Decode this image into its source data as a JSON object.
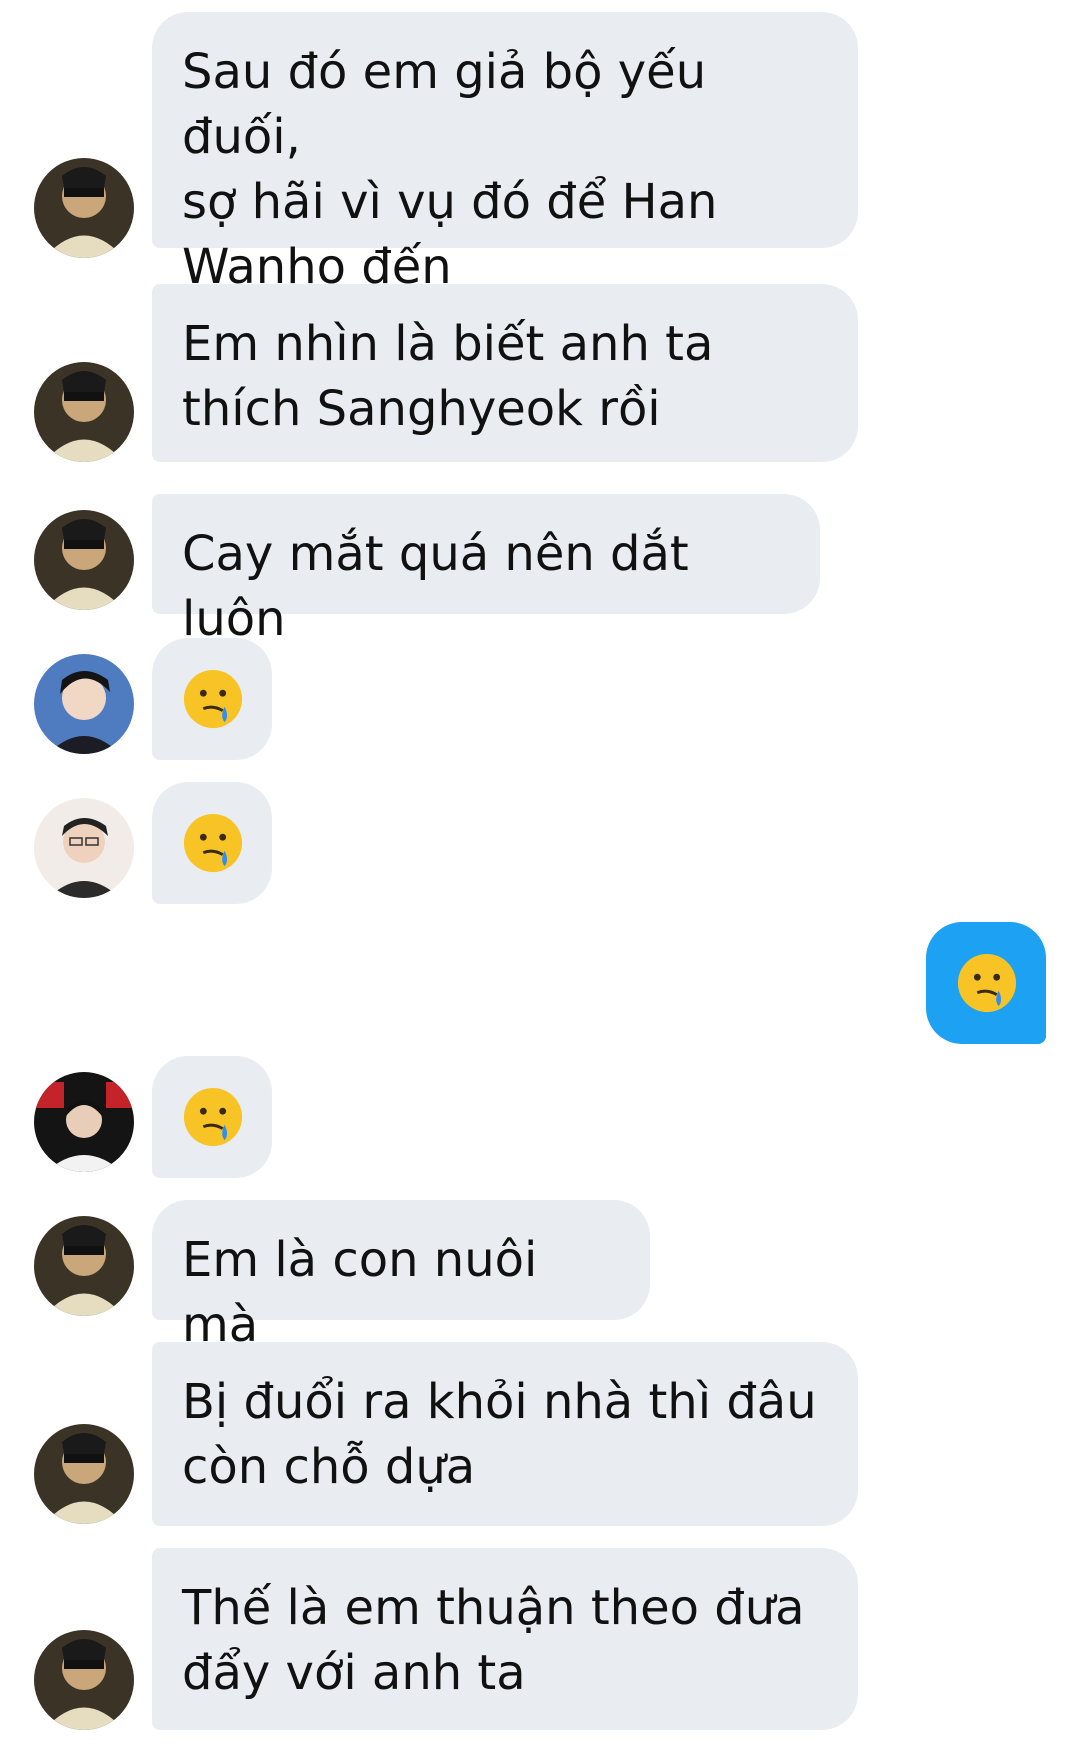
{
  "conversation": {
    "messages": [
      {
        "sender": "avatar-a",
        "text": "Sau đó em giả bộ yếu đuối,\nsợ hãi vì vụ đó để Han\nWanho đến"
      },
      {
        "sender": "avatar-a",
        "text": "Em nhìn là biết anh ta\nthích Sanghyeok rồi"
      },
      {
        "sender": "avatar-a",
        "text": "Cay mắt quá nên dắt luôn"
      },
      {
        "sender": "avatar-b",
        "emoji": "face-holding-back-tears"
      },
      {
        "sender": "avatar-c",
        "emoji": "face-holding-back-tears"
      },
      {
        "sender": "me",
        "emoji": "face-holding-back-tears"
      },
      {
        "sender": "avatar-d",
        "emoji": "face-holding-back-tears"
      },
      {
        "sender": "avatar-a",
        "text": "Em là con nuôi mà"
      },
      {
        "sender": "avatar-a",
        "text": "Bị đuổi ra khỏi nhà thì đâu\ncòn chỗ dựa"
      },
      {
        "sender": "avatar-a",
        "text": "Thế là em thuận theo đưa\nđẩy với anh ta"
      }
    ]
  },
  "colors": {
    "incoming_bubble": "#e9edf2",
    "outgoing_bubble": "#1da1f2"
  }
}
